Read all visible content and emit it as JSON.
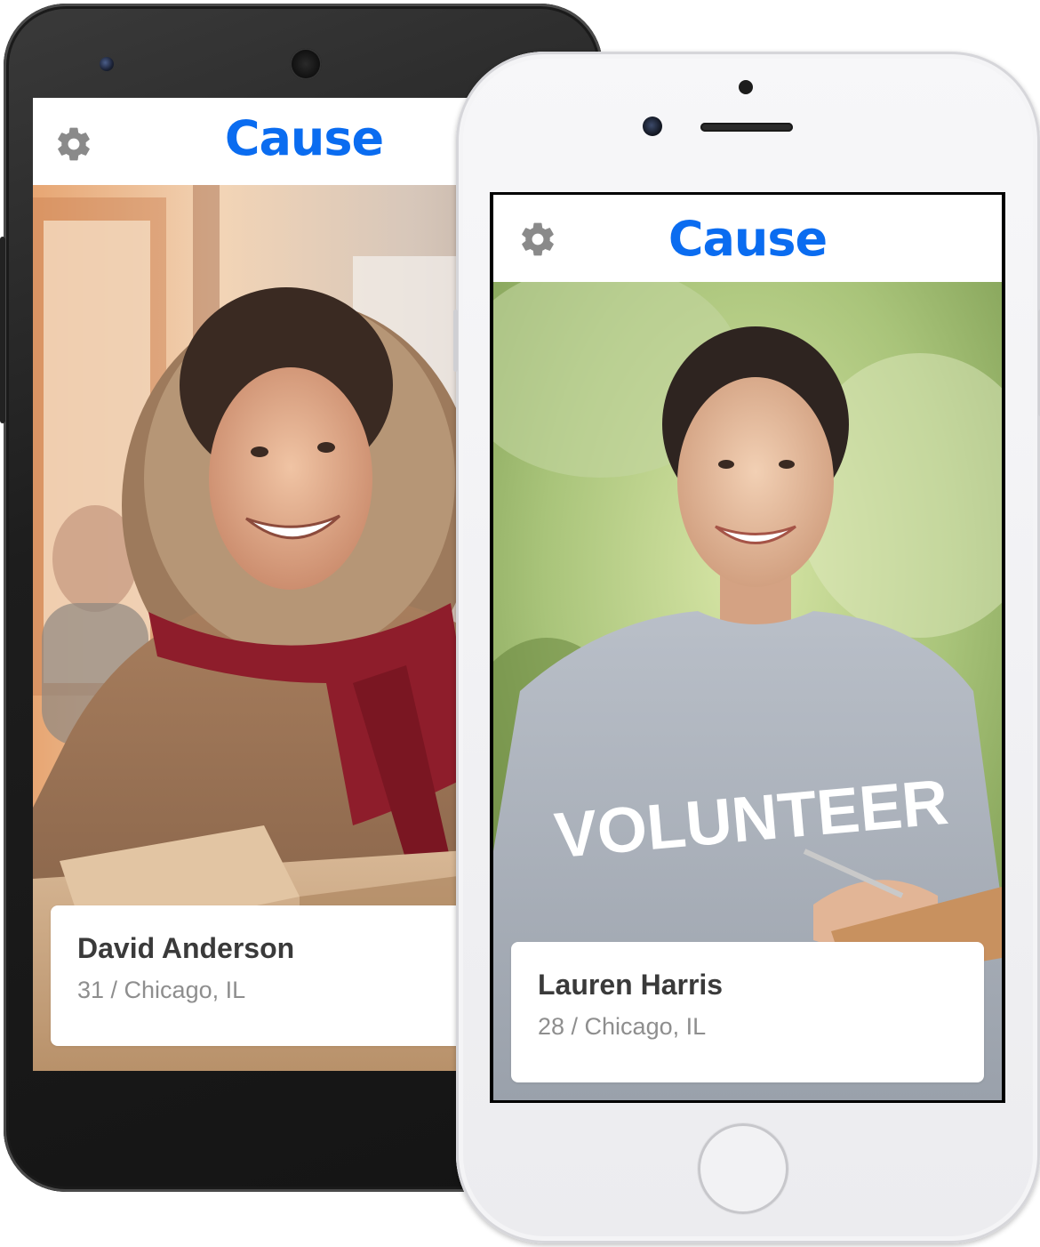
{
  "brand_color": "#0a6cf0",
  "android_phone": {
    "app_title": "Cause",
    "settings_icon": "gear-icon",
    "profile": {
      "name": "David Anderson",
      "details": "31 / Chicago, IL"
    }
  },
  "iphone": {
    "app_title": "Cause",
    "settings_icon": "gear-icon",
    "profile": {
      "name": "Lauren Harris",
      "details": "28 / Chicago, IL",
      "shirt_text": "VOLUNTEER"
    }
  }
}
